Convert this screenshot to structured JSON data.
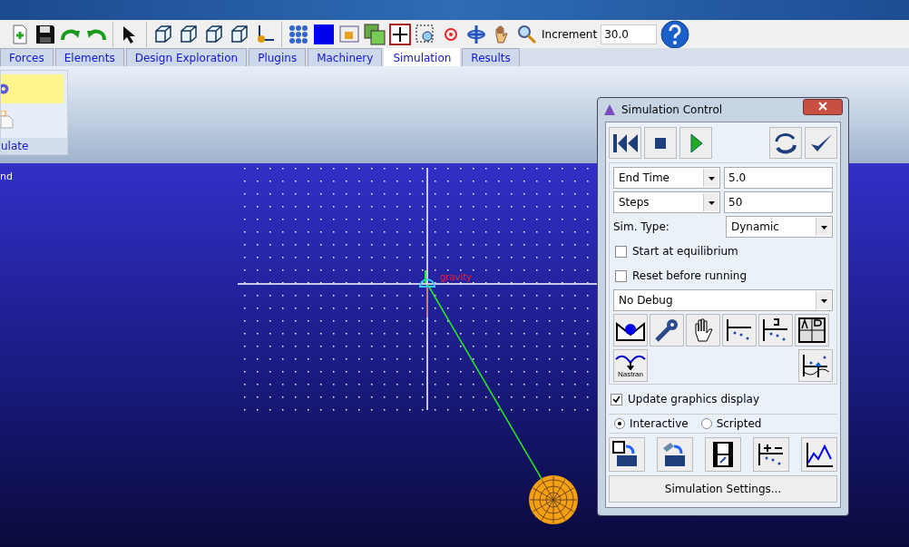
{
  "toolbar": {
    "increment_label": "Increment",
    "increment_value": "30.0"
  },
  "tabs": [
    {
      "label": "Forces",
      "selected": false
    },
    {
      "label": "Elements",
      "selected": false
    },
    {
      "label": "Design Exploration",
      "selected": false
    },
    {
      "label": "Plugins",
      "selected": false
    },
    {
      "label": "Machinery",
      "selected": false
    },
    {
      "label": "Simulation",
      "selected": true
    },
    {
      "label": "Results",
      "selected": false
    }
  ],
  "ribbon": {
    "group_label": "ulate"
  },
  "viewport": {
    "label": "nd",
    "gravity_label": "gravity"
  },
  "dialog": {
    "title": "Simulation Control",
    "end_field": {
      "option": "End Time",
      "value": "5.0"
    },
    "steps_field": {
      "option": "Steps",
      "value": "50"
    },
    "sim_type_label": "Sim. Type:",
    "sim_type": "Dynamic",
    "checks": [
      {
        "label": "Start at equilibrium",
        "checked": false
      },
      {
        "label": "Reset before running",
        "checked": false
      }
    ],
    "debug": "No Debug",
    "nastran_label": "Nastran",
    "update_graphics": {
      "label": "Update graphics display",
      "checked": true
    },
    "modes": [
      {
        "label": "Interactive",
        "selected": true
      },
      {
        "label": "Scripted",
        "selected": false
      }
    ],
    "settings_button": "Simulation Settings..."
  }
}
